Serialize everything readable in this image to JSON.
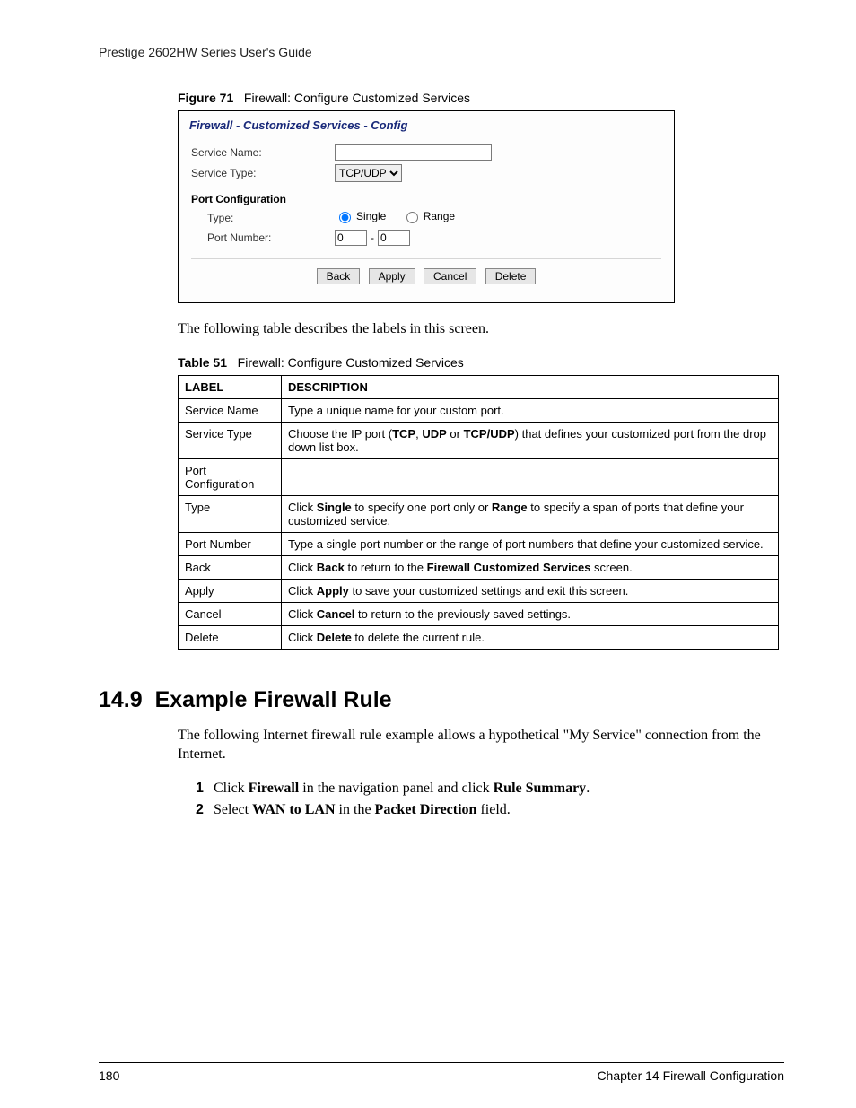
{
  "header": "Prestige 2602HW Series User's Guide",
  "figure": {
    "label": "Figure 71",
    "title": "Firewall: Configure Customized Services"
  },
  "shot": {
    "title": "Firewall - Customized Services - Config",
    "serviceNameLabel": "Service Name:",
    "serviceNameValue": "",
    "serviceTypeLabel": "Service Type:",
    "serviceTypeValue": "TCP/UDP",
    "portConfigHeading": "Port Configuration",
    "typeLabel": "Type:",
    "radioSingle": "Single",
    "radioRange": "Range",
    "portNumberLabel": "Port Number:",
    "portFrom": "0",
    "portDash": "-",
    "portTo": "0",
    "buttons": {
      "back": "Back",
      "apply": "Apply",
      "cancel": "Cancel",
      "delete": "Delete"
    }
  },
  "paraAfterFigure": "The following table describes the labels in this screen.",
  "tableCaption": {
    "label": "Table 51",
    "title": "Firewall: Configure Customized Services"
  },
  "tableHead": {
    "c1": "LABEL",
    "c2": "DESCRIPTION"
  },
  "rows": [
    {
      "label": "Service Name",
      "desc_pre": "Type a unique name for your custom port.",
      "bolds": []
    },
    {
      "label": "Service Type",
      "desc_html": "Choose the IP port (<b>TCP</b>, <b>UDP</b> or <b>TCP/UDP</b>) that defines your customized port from the drop down list box."
    },
    {
      "label": "Port Configuration",
      "desc_pre": ""
    },
    {
      "label": "Type",
      "desc_html": "Click <b>Single</b> to specify one port only or <b>Range</b> to specify a span of ports that define your customized service."
    },
    {
      "label": "Port Number",
      "desc_pre": "Type a single port number or the range of port numbers that define your customized service."
    },
    {
      "label": "Back",
      "desc_html": "Click <b>Back</b> to return to the <b>Firewall Customized Services</b> screen."
    },
    {
      "label": "Apply",
      "desc_html": "Click <b>Apply</b> to save your customized settings and exit this screen."
    },
    {
      "label": "Cancel",
      "desc_html": "Click <b>Cancel</b> to return to the previously saved settings."
    },
    {
      "label": "Delete",
      "desc_html": "Click <b>Delete</b> to delete the current rule."
    }
  ],
  "section": {
    "number": "14.9",
    "title": "Example Firewall Rule"
  },
  "sectionIntro": "The following Internet firewall rule example allows a hypothetical \"My Service\" connection from the Internet.",
  "steps": [
    {
      "n": "1",
      "html": "Click <b>Firewall</b> in the navigation panel and click <b>Rule Summary</b>."
    },
    {
      "n": "2",
      "html": "Select <b>WAN to LAN</b> in the <b>Packet Direction</b> field."
    }
  ],
  "footer": {
    "page": "180",
    "chapter": "Chapter 14 Firewall Configuration"
  }
}
